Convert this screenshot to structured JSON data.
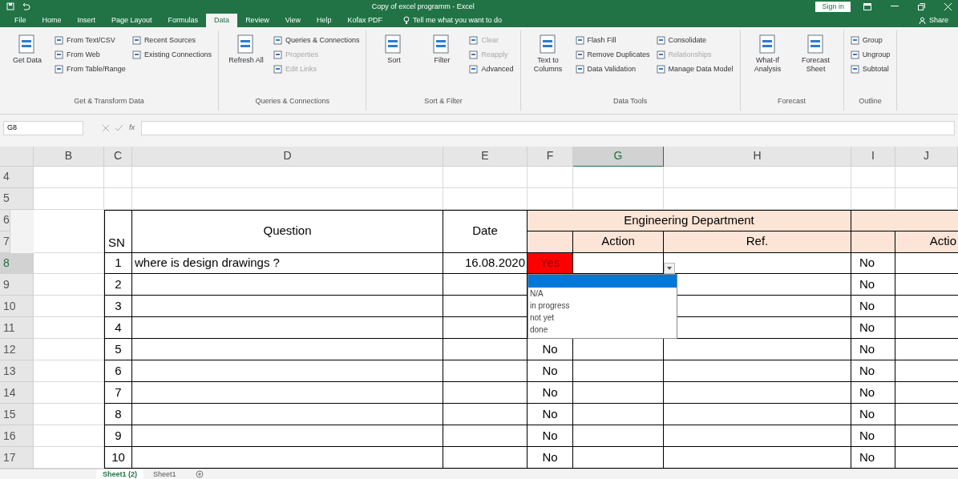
{
  "window": {
    "title": "Copy of excel programm - Excel",
    "sign_in": "Sign in",
    "share": "Share"
  },
  "ribbon_tabs": [
    {
      "label": "File",
      "selected": false
    },
    {
      "label": "Home",
      "selected": false
    },
    {
      "label": "Insert",
      "selected": false
    },
    {
      "label": "Page Layout",
      "selected": false
    },
    {
      "label": "Formulas",
      "selected": false
    },
    {
      "label": "Data",
      "selected": true
    },
    {
      "label": "Review",
      "selected": false
    },
    {
      "label": "View",
      "selected": false
    },
    {
      "label": "Help",
      "selected": false
    },
    {
      "label": "Kofax PDF",
      "selected": false
    }
  ],
  "tell_me": {
    "placeholder": "Tell me what you want to do"
  },
  "ribbon_groups": [
    {
      "label": "Get & Transform Data",
      "commands": [
        {
          "label": "Get Data",
          "kind": "large",
          "disabled": false
        },
        {
          "label": "From Text/CSV",
          "kind": "small",
          "disabled": false
        },
        {
          "label": "From Web",
          "kind": "small",
          "disabled": false
        },
        {
          "label": "From Table/Range",
          "kind": "small",
          "disabled": false
        },
        {
          "label": "Recent Sources",
          "kind": "small",
          "disabled": false
        },
        {
          "label": "Existing Connections",
          "kind": "small",
          "disabled": false
        }
      ]
    },
    {
      "label": "Queries & Connections",
      "commands": [
        {
          "label": "Refresh All",
          "kind": "large",
          "disabled": false
        },
        {
          "label": "Queries & Connections",
          "kind": "small",
          "disabled": false
        },
        {
          "label": "Properties",
          "kind": "small",
          "disabled": true
        },
        {
          "label": "Edit Links",
          "kind": "small",
          "disabled": true
        }
      ]
    },
    {
      "label": "Sort & Filter",
      "commands": [
        {
          "label": "Sort",
          "kind": "large",
          "disabled": false
        },
        {
          "label": "Filter",
          "kind": "large",
          "disabled": false
        },
        {
          "label": "Clear",
          "kind": "small",
          "disabled": true
        },
        {
          "label": "Reapply",
          "kind": "small",
          "disabled": true
        },
        {
          "label": "Advanced",
          "kind": "small",
          "disabled": false
        }
      ]
    },
    {
      "label": "Data Tools",
      "commands": [
        {
          "label": "Text to Columns",
          "kind": "large",
          "disabled": false
        },
        {
          "label": "Flash Fill",
          "kind": "small",
          "disabled": false
        },
        {
          "label": "Remove Duplicates",
          "kind": "small",
          "disabled": false
        },
        {
          "label": "Data Validation",
          "kind": "small",
          "disabled": false
        },
        {
          "label": "Consolidate",
          "kind": "small",
          "disabled": false
        },
        {
          "label": "Relationships",
          "kind": "small",
          "disabled": true
        },
        {
          "label": "Manage Data Model",
          "kind": "small",
          "disabled": false
        }
      ]
    },
    {
      "label": "Forecast",
      "commands": [
        {
          "label": "What-If Analysis",
          "kind": "large",
          "disabled": false
        },
        {
          "label": "Forecast Sheet",
          "kind": "large",
          "disabled": false
        }
      ]
    },
    {
      "label": "Outline",
      "commands": [
        {
          "label": "Group",
          "kind": "small",
          "disabled": false
        },
        {
          "label": "Ungroup",
          "kind": "small",
          "disabled": false
        },
        {
          "label": "Subtotal",
          "kind": "small",
          "disabled": false
        }
      ]
    }
  ],
  "formula_bar": {
    "name_box": "G8",
    "function_label": "fx"
  },
  "columns": [
    {
      "label": "B",
      "selected": false
    },
    {
      "label": "C",
      "selected": false
    },
    {
      "label": "D",
      "selected": false
    },
    {
      "label": "E",
      "selected": false
    },
    {
      "label": "F",
      "selected": false
    },
    {
      "label": "G",
      "selected": true
    },
    {
      "label": "H",
      "selected": false
    },
    {
      "label": "I",
      "selected": false
    },
    {
      "label": "J",
      "selected": false
    }
  ],
  "blank_rows": [
    {
      "row": "4"
    },
    {
      "row": "5"
    }
  ],
  "table_header": {
    "rows": [
      "6",
      "7"
    ],
    "sn": "SN",
    "question": "Question",
    "date": "Date",
    "group": "Engineering Department",
    "action": "Action",
    "ref": "Ref.",
    "next_action": "Actio"
  },
  "rows": [
    {
      "row": "8",
      "selected": true,
      "sn": "1",
      "question": "where is design drawings ?",
      "date": "16.08.2020",
      "answer": {
        "text": "Yes",
        "flagged": true
      },
      "next_answer": "No"
    },
    {
      "row": "9",
      "selected": false,
      "sn": "2",
      "next_answer": "No"
    },
    {
      "row": "10",
      "selected": false,
      "sn": "3",
      "next_answer": "No"
    },
    {
      "row": "11",
      "selected": false,
      "sn": "4",
      "next_answer": "No"
    },
    {
      "row": "12",
      "selected": false,
      "sn": "5",
      "answer": {
        "text": "No",
        "flagged": false
      },
      "next_answer": "No"
    },
    {
      "row": "13",
      "selected": false,
      "sn": "6",
      "answer": {
        "text": "No",
        "flagged": false
      },
      "next_answer": "No"
    },
    {
      "row": "14",
      "selected": false,
      "sn": "7",
      "answer": {
        "text": "No",
        "flagged": false
      },
      "next_answer": "No"
    },
    {
      "row": "15",
      "selected": false,
      "sn": "8",
      "answer": {
        "text": "No",
        "flagged": false
      },
      "next_answer": "No"
    },
    {
      "row": "16",
      "selected": false,
      "sn": "9",
      "answer": {
        "text": "No",
        "flagged": false
      },
      "next_answer": "No"
    },
    {
      "row": "17",
      "selected": false,
      "sn": "10",
      "answer": {
        "text": "No",
        "flagged": false
      },
      "next_answer": "No"
    }
  ],
  "dropdown": {
    "blank_option_selected": true,
    "options": [
      {
        "label": "N/A",
        "selected": false
      },
      {
        "label": "in progress",
        "selected": false
      },
      {
        "label": "not yet",
        "selected": false
      },
      {
        "label": "done",
        "selected": false
      }
    ]
  },
  "sheet_tabs": [
    {
      "label": "Sheet1 (2)",
      "selected": true
    },
    {
      "label": "Sheet1",
      "selected": false
    }
  ]
}
